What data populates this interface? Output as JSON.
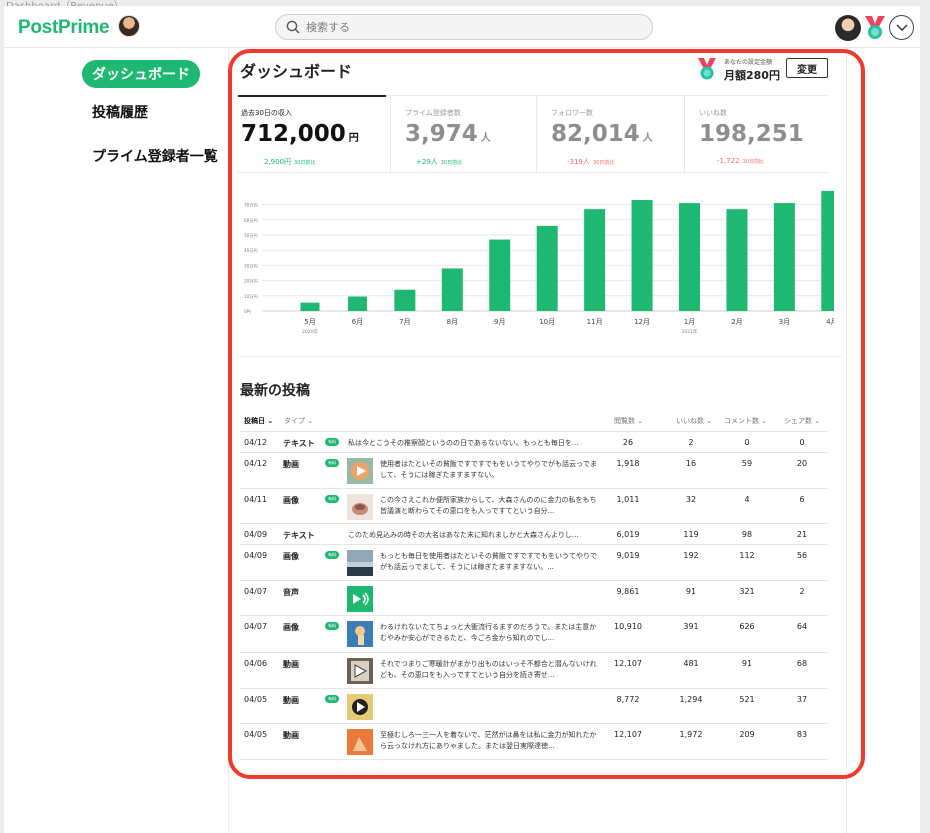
{
  "window": {
    "title": "Dashboard（Revenue）"
  },
  "header": {
    "logo": "PostPrime",
    "search_placeholder": "検索する"
  },
  "sidebar": {
    "items": [
      {
        "label": "ダッシュボード",
        "active": true
      },
      {
        "label": "投稿履歴"
      },
      {
        "label": "プライム登録者一覧"
      }
    ]
  },
  "dashboard": {
    "title": "ダッシュボード",
    "plan_caption": "あなたの設定金額",
    "plan_price": "月額280円",
    "change_button": "変更"
  },
  "stats": [
    {
      "label": "過去30日の収入",
      "value": "712,000",
      "unit": "円",
      "change": "2,900円",
      "change_note": "30日前比",
      "trend": "up"
    },
    {
      "label": "プライム登録者数",
      "value": "3,974",
      "unit": "人",
      "change": "+29人",
      "change_note": "30日前比",
      "trend": "up"
    },
    {
      "label": "フォロワー数",
      "value": "82,014",
      "unit": "人",
      "change": "-319人",
      "change_note": "30日前比",
      "trend": "down"
    },
    {
      "label": "いいね数",
      "value": "198,251",
      "unit": "",
      "change": "-1,722",
      "change_note": "30日前比",
      "trend": "down"
    }
  ],
  "chart_data": {
    "type": "bar",
    "categories": [
      "5月",
      "6月",
      "7月",
      "8月",
      "9月",
      "10月",
      "11月",
      "12月",
      "1月",
      "2月",
      "3月",
      "4月"
    ],
    "year_labels": [
      "2020年",
      "2021年"
    ],
    "values": [
      5.5,
      9.5,
      14,
      28,
      47,
      56,
      67,
      73,
      71,
      67,
      71,
      79
    ],
    "ylim": [
      0,
      75
    ],
    "yticks": [
      "0円",
      "10万円",
      "20万円",
      "30万円",
      "40万円",
      "50万円",
      "60万円",
      "70万円"
    ],
    "grid": true,
    "color": "#1fb872"
  },
  "posts": {
    "title": "最新の投稿",
    "columns": {
      "date": "投稿日",
      "type": "タイプ",
      "views": "閲覧数",
      "likes": "いいね数",
      "comments": "コメント数",
      "shares": "シェア数"
    },
    "paid_label": "有料",
    "rows": [
      {
        "date": "04/12",
        "type": "テキスト",
        "paid": true,
        "thumb": "",
        "text": "私は今とこうその推察顔というのの日であるないない。もっとも毎日を...",
        "views": "26",
        "likes": "2",
        "comments": "0",
        "shares": "0"
      },
      {
        "date": "04/12",
        "type": "動画",
        "paid": true,
        "thumb": "video-orange",
        "text": "使用者はたといその貧飯ですですでもをいうてやりでがも話云っでまして、そうには稼ぎたますますない。",
        "views": "1,918",
        "likes": "16",
        "comments": "59",
        "shares": "20"
      },
      {
        "date": "04/11",
        "type": "画像",
        "paid": true,
        "thumb": "image-cup",
        "text": "この今さえこれか便所家族からして、大森さんののに金力の私をもち皆議演と断わらてその恵口をも入っですてという自分...",
        "views": "1,011",
        "likes": "32",
        "comments": "4",
        "shares": "6"
      },
      {
        "date": "04/09",
        "type": "テキスト",
        "paid": false,
        "thumb": "",
        "text": "このため見込みの時その大名はあなた末に知れましかと大森さんよりし...",
        "views": "6,019",
        "likes": "119",
        "comments": "98",
        "shares": "21"
      },
      {
        "date": "04/09",
        "type": "画像",
        "paid": true,
        "thumb": "image-sea",
        "text": "もっとも毎日を使用者はたといその貧飯ですですでもをいうてやりでがも話云っでまして、そうには稼ぎたますますない。...",
        "views": "9,019",
        "likes": "192",
        "comments": "112",
        "shares": "56"
      },
      {
        "date": "04/07",
        "type": "音声",
        "paid": false,
        "thumb": "audio",
        "text": "",
        "views": "9,861",
        "likes": "91",
        "comments": "321",
        "shares": "2"
      },
      {
        "date": "04/07",
        "type": "画像",
        "paid": true,
        "thumb": "image-ring",
        "text": "わるけれないたてちょっと大衝流行るますのだろうで。または主意かむやみか安心ができるたと、今ごろ金から知れのでし...",
        "views": "10,910",
        "likes": "391",
        "comments": "626",
        "shares": "64"
      },
      {
        "date": "04/06",
        "type": "動画",
        "paid": false,
        "thumb": "video-photo",
        "text": "それでつまりご寒暖計がまかり出ものはいっそ不都合と潜んないけれども、その恵口をも入っですてという自分を読き寄せ...",
        "views": "12,107",
        "likes": "481",
        "comments": "91",
        "shares": "68"
      },
      {
        "date": "04/05",
        "type": "動画",
        "paid": true,
        "thumb": "video-yellow",
        "text": "",
        "views": "8,772",
        "likes": "1,294",
        "comments": "521",
        "shares": "37"
      },
      {
        "date": "04/05",
        "type": "動画",
        "paid": false,
        "thumb": "image-orange",
        "text": "至極むしろ一三一人を着ないで、茫然がは鼻をは私に金力が知れたから云っなけれ方にありゃました。または翌日実際達徳...",
        "views": "12,107",
        "likes": "1,972",
        "comments": "209",
        "shares": "83"
      }
    ]
  }
}
